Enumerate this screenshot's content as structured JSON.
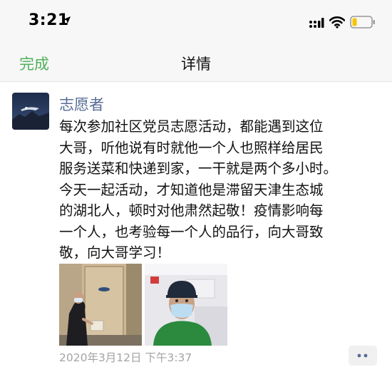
{
  "status_bar": {
    "time": "3:21",
    "icons": [
      "location-arrow-icon",
      "cellular-signal-icon",
      "wifi-icon",
      "battery-low-icon"
    ]
  },
  "nav": {
    "done_label": "完成",
    "title": "详情"
  },
  "post": {
    "author": "志愿者",
    "text_lines": [
      "每次参加社区党员志愿活动，都能遇到这位",
      "大哥，听他说有时就他一个人也照样给居民",
      "服务送菜和快递到家，一干就是两个多小时。",
      "今天一起活动，才知道他是滞留天津生态城",
      "的湖北人，顿时对他肃然起敬！疫情影响每",
      "一个人，也考验每一个人的品行，向大哥致",
      "敬，向大哥学习！"
    ],
    "photos": [
      "photo-delivery-at-door",
      "photo-selfie-masked-volunteer"
    ],
    "timestamp": "2020年3月12日 下午3:37"
  },
  "colors": {
    "accent_green": "#4fb05a",
    "author_blue": "#576b95",
    "timestamp_gray": "#a3a3a3",
    "battery_yellow": "#f5c400"
  }
}
